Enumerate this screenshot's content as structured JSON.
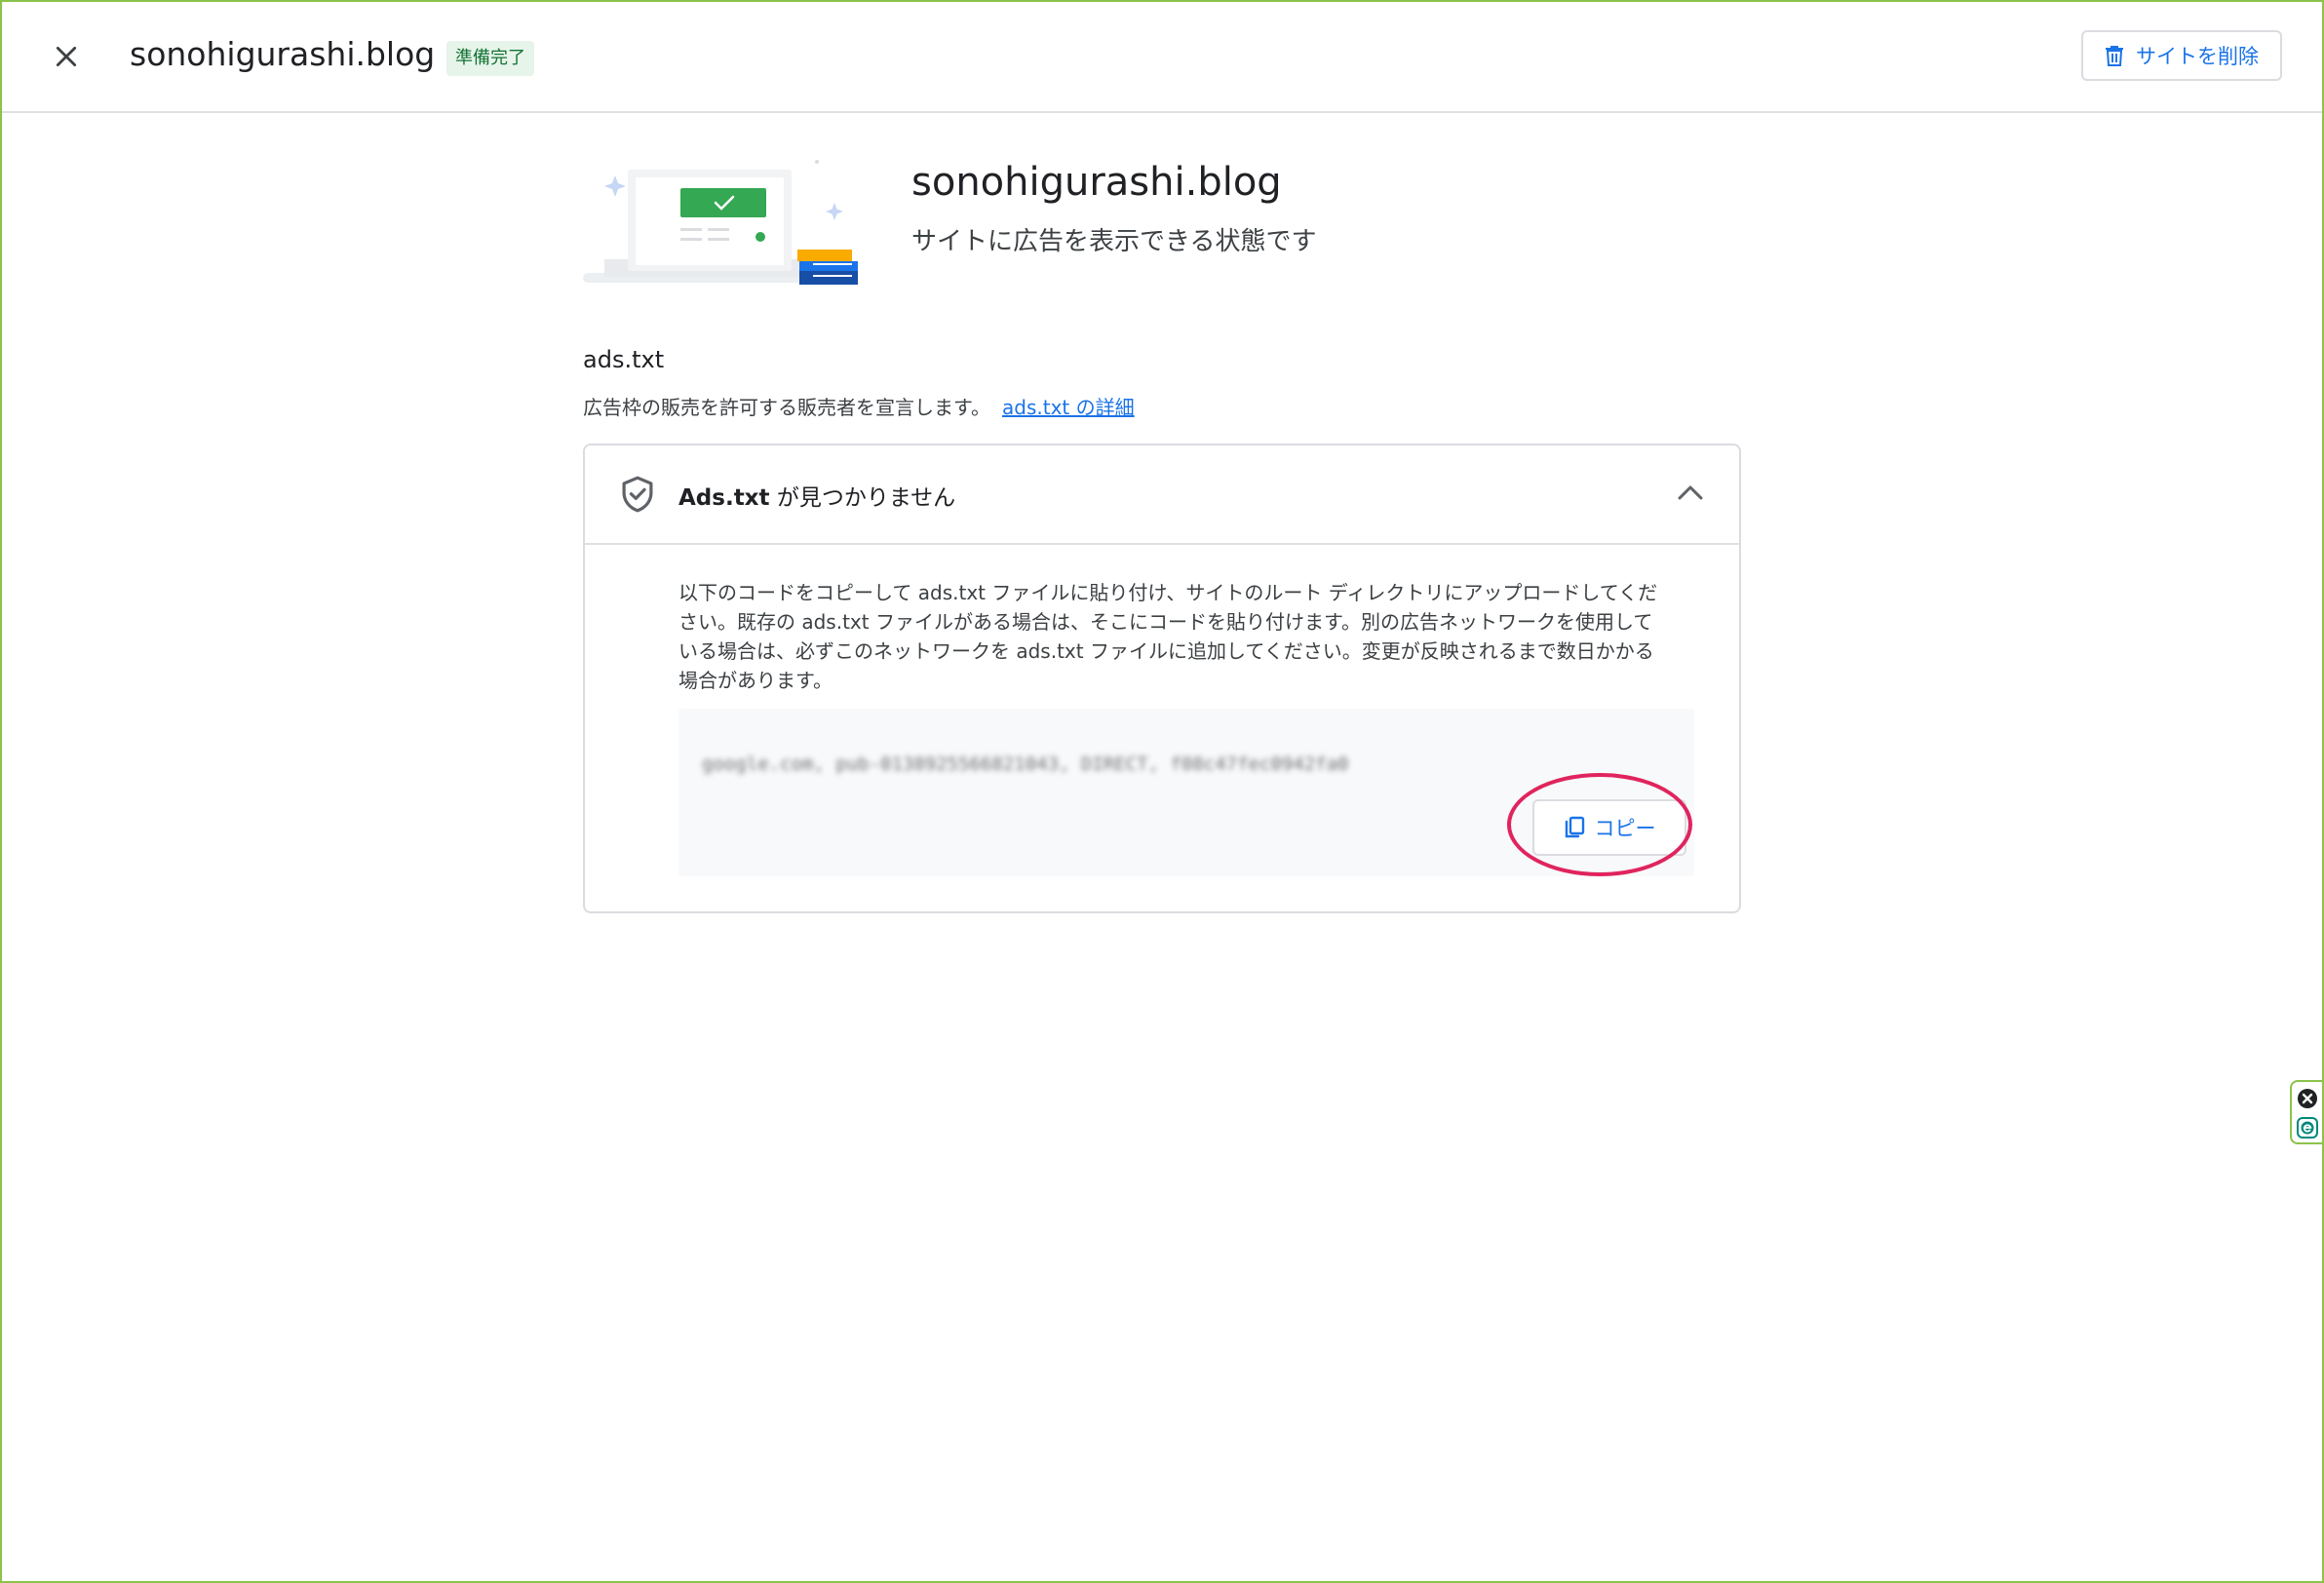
{
  "header": {
    "site_name": "sonohigurashi.blog",
    "status": "準備完了",
    "delete_label": "サイトを削除"
  },
  "hero": {
    "title": "sonohigurashi.blog",
    "subtitle": "サイトに広告を表示できる状態です"
  },
  "ads_section": {
    "title": "ads.txt",
    "description": "広告枠の販売を許可する販売者を宣言します。",
    "link_text": "ads.txt の詳細"
  },
  "card": {
    "header_bold": "Ads.txt",
    "header_rest": " が見つかりません",
    "body": "以下のコードをコピーして ads.txt ファイルに貼り付け、サイトのルート ディレクトリにアップロードしてください。既存の ads.txt ファイルがある場合は、そこにコードを貼り付けます。別の広告ネットワークを使用している場合は、必ずこのネットワークを ads.txt ファイルに追加してください。変更が反映されるまで数日かかる場合があります。",
    "code": "google.com, pub-0138925566821043, DIRECT, f08c47fec0942fa0",
    "copy_label": "コピー"
  },
  "colors": {
    "accent": "#1a73e8",
    "status_bg": "#e6f4ea",
    "status_text": "#137333",
    "highlight": "#e0245e",
    "frame": "#8bc34a"
  }
}
